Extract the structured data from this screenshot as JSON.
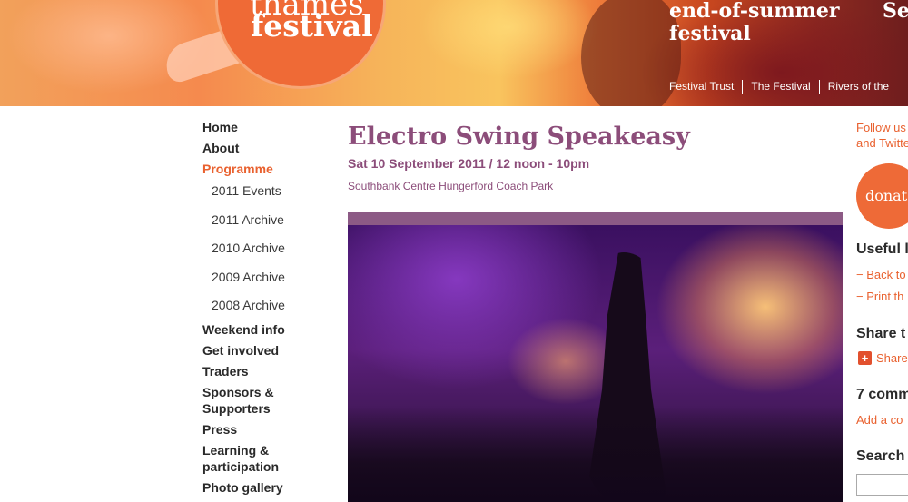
{
  "header": {
    "logo_top": "thames",
    "logo": "festival",
    "tagline_line1": "end-of-summer",
    "tagline_line2": "festival",
    "tagline_extra": "Se",
    "nav": [
      "Festival Trust",
      "The Festival",
      "Rivers of the"
    ]
  },
  "sidebar": {
    "items_top": [
      {
        "label": "Home",
        "active": false
      },
      {
        "label": "About",
        "active": false
      },
      {
        "label": "Programme",
        "active": true
      }
    ],
    "sub_items": [
      "2011 Events",
      "2011 Archive",
      "2010 Archive",
      "2009 Archive",
      "2008 Archive"
    ],
    "items_bottom": [
      {
        "label": "Weekend info"
      },
      {
        "label": "Get involved"
      },
      {
        "label": "Traders"
      },
      {
        "label": "Sponsors & Supporters"
      },
      {
        "label": "Press"
      },
      {
        "label": "Learning & participation"
      },
      {
        "label": "Photo gallery"
      }
    ]
  },
  "event": {
    "title": "Electro Swing Speakeasy",
    "date": "Sat 10 September 2011 / 12 noon - 10pm",
    "venue": "Southbank Centre Hungerford Coach Park"
  },
  "right": {
    "follow_line1": "Follow us",
    "follow_line2": "and Twitte",
    "donate": "donat",
    "useful_heading": "Useful l",
    "useful_links": [
      "− Back to",
      "− Print th"
    ],
    "share_heading": "Share t",
    "share_label": "Share",
    "comments_heading": "7 comm",
    "add_comment": "Add a co",
    "search_heading": "Search"
  },
  "colors": {
    "accent_orange": "#e9612f",
    "title_purple": "#8c4d7a",
    "photo_frame": "#8c5a85"
  }
}
